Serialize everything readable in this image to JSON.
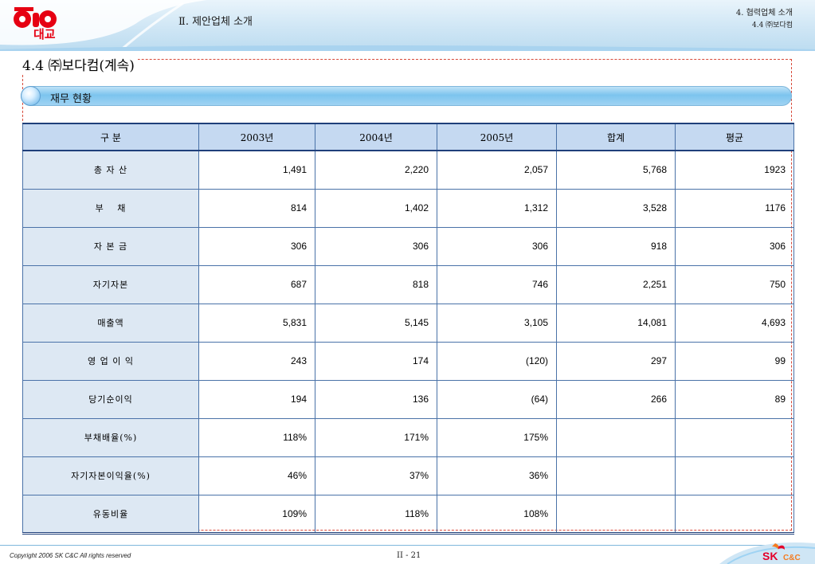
{
  "header": {
    "logo_text": "대교",
    "section_title": "Ⅱ. 제안업체 소개",
    "nav_line1": "4. 협력업체 소개",
    "nav_line2": "4.4 ㈜보다컴"
  },
  "page_heading": "4.4 ㈜보다컴(계속)",
  "subtitle": "재무 현황",
  "table": {
    "columns": [
      "구 분",
      "2003년",
      "2004년",
      "2005년",
      "합계",
      "평균"
    ],
    "rows": [
      {
        "label": "총 자 산",
        "values": [
          "1,491",
          "2,220",
          "2,057",
          "5,768",
          "1923"
        ]
      },
      {
        "label": "부　 채",
        "values": [
          "814",
          "1,402",
          "1,312",
          "3,528",
          "1176"
        ]
      },
      {
        "label": "자 본 금",
        "values": [
          "306",
          "306",
          "306",
          "918",
          "306"
        ]
      },
      {
        "label": "자기자본",
        "values": [
          "687",
          "818",
          "746",
          "2,251",
          "750"
        ]
      },
      {
        "label": "매출액",
        "values": [
          "5,831",
          "5,145",
          "3,105",
          "14,081",
          "4,693"
        ]
      },
      {
        "label": "영 업 이 익",
        "values": [
          "243",
          "174",
          "(120)",
          "297",
          "99"
        ]
      },
      {
        "label": "당기순이익",
        "values": [
          "194",
          "136",
          "(64)",
          "266",
          "89"
        ]
      },
      {
        "label": "부채배율(%)",
        "values": [
          "118%",
          "171%",
          "175%",
          "",
          ""
        ]
      },
      {
        "label": "자기자본이익율(%)",
        "values": [
          "46%",
          "37%",
          "36%",
          "",
          ""
        ]
      },
      {
        "label": "유동비율",
        "values": [
          "109%",
          "118%",
          "108%",
          "",
          ""
        ]
      }
    ]
  },
  "footer": {
    "copyright": "Copyright 2006 SK C&C All rights reserved",
    "page_number": "II - 21",
    "sk_logo_sk": "SK",
    "sk_logo_cc": "C&C"
  },
  "colors": {
    "header_blue": "#cfe6f5",
    "table_header": "#c5d9f1",
    "row_label_bg": "#dde8f3",
    "frame_dash": "#d84a3a",
    "sk_red": "#e4002b",
    "sk_orange": "#f47b20"
  }
}
